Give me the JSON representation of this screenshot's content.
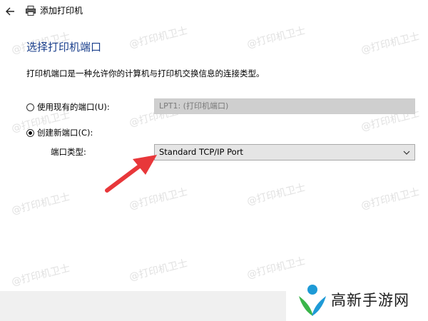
{
  "window": {
    "title": "添加打印机"
  },
  "header": {
    "heading": "选择打印机端口",
    "description": "打印机端口是一种允许你的计算机与打印机交换信息的连接类型。"
  },
  "options": {
    "use_existing_label": "使用现有的端口(U):",
    "existing_port_value": "LPT1: (打印机端口)",
    "create_new_label": "创建新端口(C):",
    "port_type_label": "端口类型:",
    "port_type_value": "Standard TCP/IP Port"
  },
  "watermark": {
    "text": "@打印机卫士"
  },
  "badge": {
    "text": "高新手游网"
  },
  "colors": {
    "heading": "#1a3f8c",
    "arrow": "#e8373a",
    "logo_green": "#3ab54a",
    "logo_teal": "#1e9ad6"
  },
  "icons": {
    "back": "back-arrow-icon",
    "printer": "printer-icon",
    "dropdown": "chevron-down-icon",
    "annotation": "red-arrow-icon"
  }
}
